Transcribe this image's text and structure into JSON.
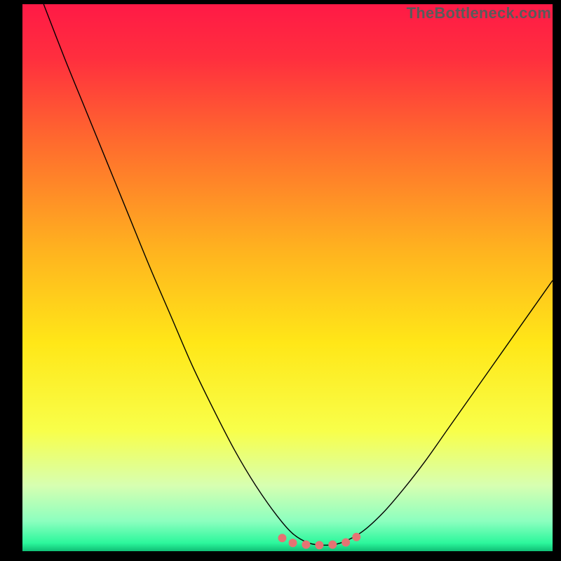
{
  "watermark": "TheBottleneck.com",
  "chart_data": {
    "type": "line",
    "title": "",
    "xlabel": "",
    "ylabel": "",
    "xlim": [
      0,
      100
    ],
    "ylim": [
      0,
      100
    ],
    "grid": false,
    "legend": false,
    "background_gradient": {
      "stops": [
        {
          "offset": 0.0,
          "color": "#ff1a46"
        },
        {
          "offset": 0.1,
          "color": "#ff2f3e"
        },
        {
          "offset": 0.25,
          "color": "#ff6a2e"
        },
        {
          "offset": 0.45,
          "color": "#ffb31f"
        },
        {
          "offset": 0.62,
          "color": "#ffe718"
        },
        {
          "offset": 0.78,
          "color": "#f8ff4a"
        },
        {
          "offset": 0.88,
          "color": "#d7ffb1"
        },
        {
          "offset": 0.945,
          "color": "#8cffbf"
        },
        {
          "offset": 0.985,
          "color": "#2cf79c"
        },
        {
          "offset": 1.0,
          "color": "#0fbf75"
        }
      ]
    },
    "series": [
      {
        "name": "bottleneck-curve",
        "color": "#000000",
        "stroke_width": 1.4,
        "x": [
          4,
          8,
          12,
          16,
          20,
          24,
          28,
          32,
          36,
          40,
          44,
          48,
          51,
          54,
          57,
          60,
          64,
          68,
          72,
          76,
          80,
          84,
          88,
          92,
          96,
          100
        ],
        "y": [
          100,
          90,
          80.5,
          71,
          61.5,
          52,
          43,
          34,
          26,
          18.5,
          12,
          6.5,
          3.2,
          1.5,
          1.1,
          1.5,
          3.5,
          7,
          11.5,
          16.5,
          22,
          27.5,
          33,
          38.5,
          44,
          49.5
        ]
      },
      {
        "name": "trough-highlight",
        "type": "scatter",
        "color": "#e57373",
        "radius": 6,
        "x": [
          49,
          51,
          53.5,
          56,
          58.5,
          61,
          63
        ],
        "y": [
          2.4,
          1.5,
          1.2,
          1.1,
          1.2,
          1.6,
          2.6
        ]
      }
    ]
  }
}
